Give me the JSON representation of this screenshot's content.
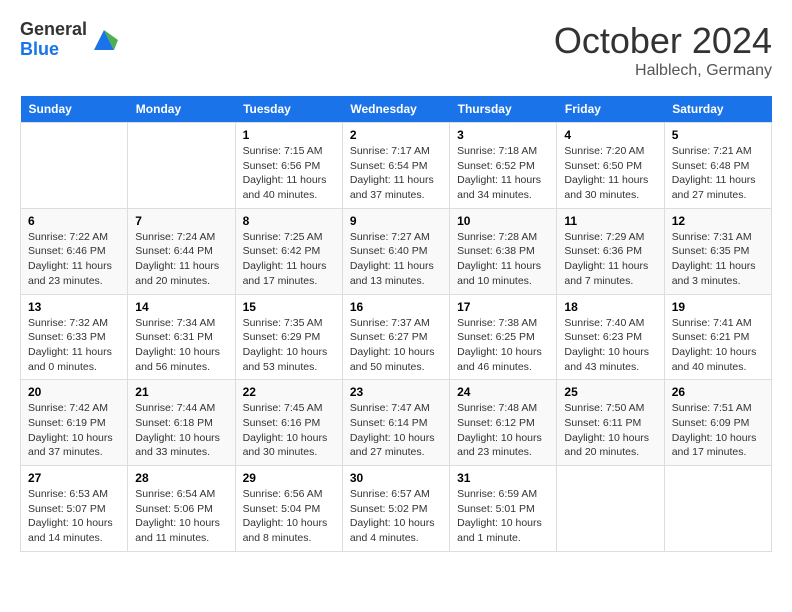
{
  "header": {
    "logo_general": "General",
    "logo_blue": "Blue",
    "month": "October 2024",
    "location": "Halblech, Germany"
  },
  "days_of_week": [
    "Sunday",
    "Monday",
    "Tuesday",
    "Wednesday",
    "Thursday",
    "Friday",
    "Saturday"
  ],
  "weeks": [
    [
      {
        "day": "",
        "sunrise": "",
        "sunset": "",
        "daylight": ""
      },
      {
        "day": "",
        "sunrise": "",
        "sunset": "",
        "daylight": ""
      },
      {
        "day": "1",
        "sunrise": "Sunrise: 7:15 AM",
        "sunset": "Sunset: 6:56 PM",
        "daylight": "Daylight: 11 hours and 40 minutes."
      },
      {
        "day": "2",
        "sunrise": "Sunrise: 7:17 AM",
        "sunset": "Sunset: 6:54 PM",
        "daylight": "Daylight: 11 hours and 37 minutes."
      },
      {
        "day": "3",
        "sunrise": "Sunrise: 7:18 AM",
        "sunset": "Sunset: 6:52 PM",
        "daylight": "Daylight: 11 hours and 34 minutes."
      },
      {
        "day": "4",
        "sunrise": "Sunrise: 7:20 AM",
        "sunset": "Sunset: 6:50 PM",
        "daylight": "Daylight: 11 hours and 30 minutes."
      },
      {
        "day": "5",
        "sunrise": "Sunrise: 7:21 AM",
        "sunset": "Sunset: 6:48 PM",
        "daylight": "Daylight: 11 hours and 27 minutes."
      }
    ],
    [
      {
        "day": "6",
        "sunrise": "Sunrise: 7:22 AM",
        "sunset": "Sunset: 6:46 PM",
        "daylight": "Daylight: 11 hours and 23 minutes."
      },
      {
        "day": "7",
        "sunrise": "Sunrise: 7:24 AM",
        "sunset": "Sunset: 6:44 PM",
        "daylight": "Daylight: 11 hours and 20 minutes."
      },
      {
        "day": "8",
        "sunrise": "Sunrise: 7:25 AM",
        "sunset": "Sunset: 6:42 PM",
        "daylight": "Daylight: 11 hours and 17 minutes."
      },
      {
        "day": "9",
        "sunrise": "Sunrise: 7:27 AM",
        "sunset": "Sunset: 6:40 PM",
        "daylight": "Daylight: 11 hours and 13 minutes."
      },
      {
        "day": "10",
        "sunrise": "Sunrise: 7:28 AM",
        "sunset": "Sunset: 6:38 PM",
        "daylight": "Daylight: 11 hours and 10 minutes."
      },
      {
        "day": "11",
        "sunrise": "Sunrise: 7:29 AM",
        "sunset": "Sunset: 6:36 PM",
        "daylight": "Daylight: 11 hours and 7 minutes."
      },
      {
        "day": "12",
        "sunrise": "Sunrise: 7:31 AM",
        "sunset": "Sunset: 6:35 PM",
        "daylight": "Daylight: 11 hours and 3 minutes."
      }
    ],
    [
      {
        "day": "13",
        "sunrise": "Sunrise: 7:32 AM",
        "sunset": "Sunset: 6:33 PM",
        "daylight": "Daylight: 11 hours and 0 minutes."
      },
      {
        "day": "14",
        "sunrise": "Sunrise: 7:34 AM",
        "sunset": "Sunset: 6:31 PM",
        "daylight": "Daylight: 10 hours and 56 minutes."
      },
      {
        "day": "15",
        "sunrise": "Sunrise: 7:35 AM",
        "sunset": "Sunset: 6:29 PM",
        "daylight": "Daylight: 10 hours and 53 minutes."
      },
      {
        "day": "16",
        "sunrise": "Sunrise: 7:37 AM",
        "sunset": "Sunset: 6:27 PM",
        "daylight": "Daylight: 10 hours and 50 minutes."
      },
      {
        "day": "17",
        "sunrise": "Sunrise: 7:38 AM",
        "sunset": "Sunset: 6:25 PM",
        "daylight": "Daylight: 10 hours and 46 minutes."
      },
      {
        "day": "18",
        "sunrise": "Sunrise: 7:40 AM",
        "sunset": "Sunset: 6:23 PM",
        "daylight": "Daylight: 10 hours and 43 minutes."
      },
      {
        "day": "19",
        "sunrise": "Sunrise: 7:41 AM",
        "sunset": "Sunset: 6:21 PM",
        "daylight": "Daylight: 10 hours and 40 minutes."
      }
    ],
    [
      {
        "day": "20",
        "sunrise": "Sunrise: 7:42 AM",
        "sunset": "Sunset: 6:19 PM",
        "daylight": "Daylight: 10 hours and 37 minutes."
      },
      {
        "day": "21",
        "sunrise": "Sunrise: 7:44 AM",
        "sunset": "Sunset: 6:18 PM",
        "daylight": "Daylight: 10 hours and 33 minutes."
      },
      {
        "day": "22",
        "sunrise": "Sunrise: 7:45 AM",
        "sunset": "Sunset: 6:16 PM",
        "daylight": "Daylight: 10 hours and 30 minutes."
      },
      {
        "day": "23",
        "sunrise": "Sunrise: 7:47 AM",
        "sunset": "Sunset: 6:14 PM",
        "daylight": "Daylight: 10 hours and 27 minutes."
      },
      {
        "day": "24",
        "sunrise": "Sunrise: 7:48 AM",
        "sunset": "Sunset: 6:12 PM",
        "daylight": "Daylight: 10 hours and 23 minutes."
      },
      {
        "day": "25",
        "sunrise": "Sunrise: 7:50 AM",
        "sunset": "Sunset: 6:11 PM",
        "daylight": "Daylight: 10 hours and 20 minutes."
      },
      {
        "day": "26",
        "sunrise": "Sunrise: 7:51 AM",
        "sunset": "Sunset: 6:09 PM",
        "daylight": "Daylight: 10 hours and 17 minutes."
      }
    ],
    [
      {
        "day": "27",
        "sunrise": "Sunrise: 6:53 AM",
        "sunset": "Sunset: 5:07 PM",
        "daylight": "Daylight: 10 hours and 14 minutes."
      },
      {
        "day": "28",
        "sunrise": "Sunrise: 6:54 AM",
        "sunset": "Sunset: 5:06 PM",
        "daylight": "Daylight: 10 hours and 11 minutes."
      },
      {
        "day": "29",
        "sunrise": "Sunrise: 6:56 AM",
        "sunset": "Sunset: 5:04 PM",
        "daylight": "Daylight: 10 hours and 8 minutes."
      },
      {
        "day": "30",
        "sunrise": "Sunrise: 6:57 AM",
        "sunset": "Sunset: 5:02 PM",
        "daylight": "Daylight: 10 hours and 4 minutes."
      },
      {
        "day": "31",
        "sunrise": "Sunrise: 6:59 AM",
        "sunset": "Sunset: 5:01 PM",
        "daylight": "Daylight: 10 hours and 1 minute."
      },
      {
        "day": "",
        "sunrise": "",
        "sunset": "",
        "daylight": ""
      },
      {
        "day": "",
        "sunrise": "",
        "sunset": "",
        "daylight": ""
      }
    ]
  ]
}
